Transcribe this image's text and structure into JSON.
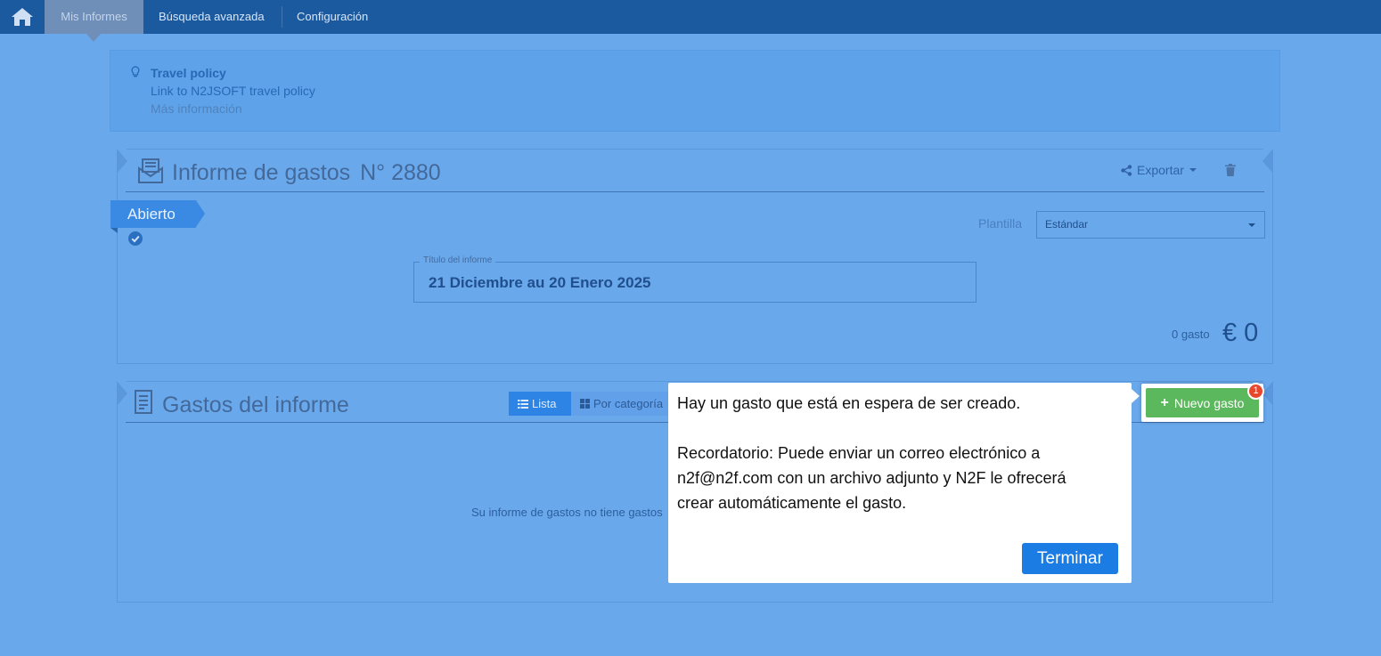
{
  "nav": {
    "home_icon": "home-icon",
    "items": [
      {
        "label": "Mis Informes",
        "active": true
      },
      {
        "label": "Búsqueda avanzada"
      },
      {
        "label": "Configuración"
      }
    ]
  },
  "policy": {
    "title": "Travel policy",
    "link": "Link to N2JSOFT travel policy",
    "more": "Más información"
  },
  "report": {
    "title": "Informe de gastos",
    "number": "N°  2880",
    "export_label": "Exportar",
    "status": "Abierto",
    "template_label": "Plantilla",
    "template_value": "Estándar",
    "title_field_label": "Título del informe",
    "title_field_value": "21 Diciembre au 20 Enero 2025",
    "expense_count": "0 gasto",
    "total": "€ 0"
  },
  "expenses": {
    "title": "Gastos del informe",
    "view_list": "Lista",
    "view_category": "Por categoría",
    "empty_message": "Su informe de gastos no tiene gastos"
  },
  "popover": {
    "line1": "Hay un gasto que está en espera de ser creado.",
    "line2": "Recordatorio: Puede enviar un correo electrónico a",
    "line3": "n2f@n2f.com con un archivo adjunto y N2F le ofrecerá",
    "line4": "crear automáticamente el gasto.",
    "finish_label": "Terminar"
  },
  "new_expense": {
    "label": "Nuevo gasto",
    "badge": "1"
  },
  "colors": {
    "nav_bg": "#1c5aa0",
    "page_bg": "#6aa8ec",
    "accent": "#1b7ce4",
    "success": "#5cb85c",
    "badge": "#e7472c"
  }
}
